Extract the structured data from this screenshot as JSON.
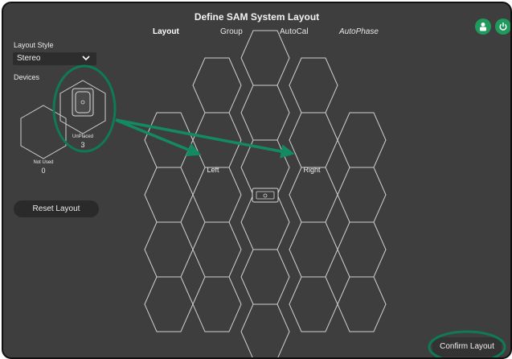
{
  "window": {
    "title": "Define SAM System Layout"
  },
  "tabs": [
    {
      "label": "Layout"
    },
    {
      "label": "Group"
    },
    {
      "label": "AutoCal"
    },
    {
      "label": "AutoPhase"
    }
  ],
  "header_icons": [
    "user-icon",
    "power-icon"
  ],
  "sidebar": {
    "layout_style_label": "Layout Style",
    "layout_style_value": "Stereo",
    "devices_label": "Devices",
    "unplaced_label": "UnPlaced",
    "unplaced_count": "3",
    "not_used_label": "Not Used",
    "not_used_count": "0",
    "reset_button": "Reset Layout"
  },
  "grid": {
    "left_label": "Left",
    "right_label": "Right",
    "center_icon": "controller-device-icon"
  },
  "footer": {
    "confirm_button": "Confirm Layout"
  },
  "colors": {
    "background": "#3e3e3e",
    "accent_green": "#1f9a5c",
    "annotation_green": "#0f7a56"
  }
}
